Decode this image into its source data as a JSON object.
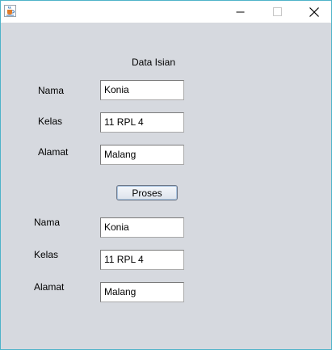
{
  "window": {
    "icon": "java-cup-icon",
    "controls": {
      "minimize": "minimize-icon",
      "maximize": "maximize-icon",
      "close": "close-icon"
    }
  },
  "form": {
    "heading": "Data Isian",
    "input": {
      "nama_label": "Nama",
      "nama_value": "Konia",
      "kelas_label": "Kelas",
      "kelas_value": "11 RPL 4",
      "alamat_label": "Alamat",
      "alamat_value": "Malang"
    },
    "button_label": "Proses",
    "output": {
      "nama_label": "Nama",
      "nama_value": "Konia",
      "kelas_label": "Kelas",
      "kelas_value": "11 RPL 4",
      "alamat_label": "Alamat",
      "alamat_value": "Malang"
    }
  },
  "colors": {
    "client_background": "#d6d9df",
    "titlebar_background": "#ffffff",
    "window_border": "#4fb3c9"
  }
}
